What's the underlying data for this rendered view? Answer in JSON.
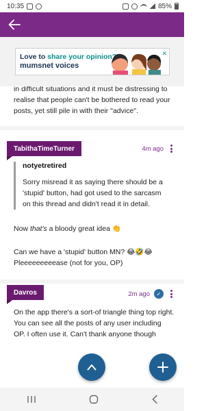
{
  "status_bar": {
    "time": "10:35",
    "battery": "85%"
  },
  "app_bar": {
    "back_icon": "arrow-left-icon",
    "color": "#7b2a87"
  },
  "ad": {
    "line1_prefix": "Love to ",
    "line1_highlight": "share your opinion?",
    "line2": "mumsnet voices",
    "close_glyph": "✕"
  },
  "thread": {
    "cut_text": "in difficult situations and it must be distressing to realise that people can't be bothered to read your posts, yet still pile in with their \"advice\"."
  },
  "posts": [
    {
      "username": "TabithaTimeTurner",
      "time": "4m ago",
      "quote_author": "notyetretired",
      "quote_text": "Sorry misread it as saying there should be a 'stupid' button, had got used to the sarcasm on this thread and didn't read it in detail.",
      "para1_prefix": "Now ",
      "para1_em": "that's",
      "para1_suffix": " a bloody great idea 👏",
      "para2_line1": "Can we have a 'stupid' button MN? 😂🤣😂",
      "para2_line2": "Pleeeeeeeeease (not for you, OP)"
    },
    {
      "username": "Davros",
      "time": "2m ago",
      "badge": "✓",
      "text": "On the app there's a sort-of triangle thing top right. You can see all the posts of any user including OP. I often use it. Can't thank anyone though"
    }
  ],
  "fabs": {
    "scroll_icon": "chevron-up-icon",
    "add_icon": "plus-icon"
  },
  "colors": {
    "accent": "#7b2a87",
    "user_tag": "#6a1b6f",
    "fab": "#1f5f92"
  }
}
